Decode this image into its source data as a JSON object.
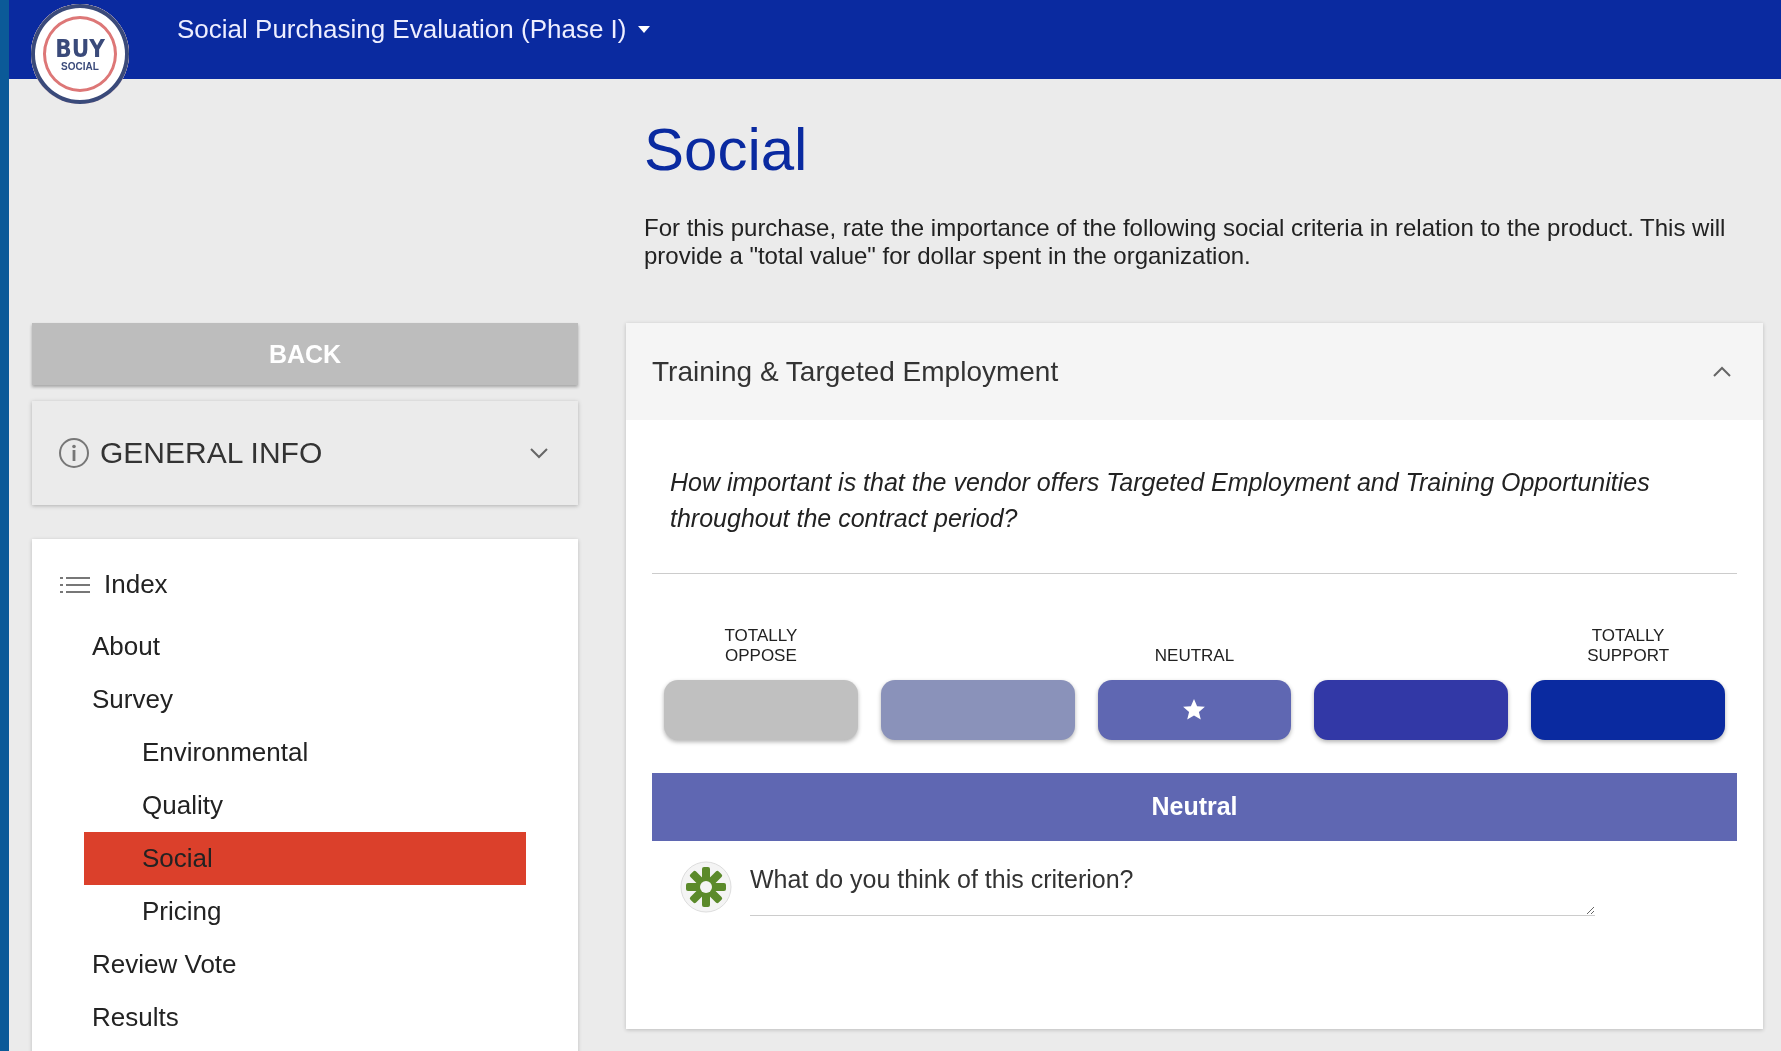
{
  "header": {
    "logo": {
      "line_1": "BUY",
      "line_2": "SOCIAL"
    },
    "title": "Social Purchasing Evaluation (Phase I)"
  },
  "sidebar": {
    "back_button": "BACK",
    "general_info": {
      "label": "GENERAL INFO",
      "expanded": false
    },
    "index": {
      "title": "Index",
      "items": [
        {
          "label": "About",
          "selected": false
        },
        {
          "label": "Survey",
          "selected": false,
          "children": [
            {
              "label": "Environmental",
              "selected": false
            },
            {
              "label": "Quality",
              "selected": false
            },
            {
              "label": "Social",
              "selected": true
            },
            {
              "label": "Pricing",
              "selected": false
            }
          ]
        },
        {
          "label": "Review Vote",
          "selected": false
        },
        {
          "label": "Results",
          "selected": false
        }
      ]
    }
  },
  "page": {
    "title": "Social",
    "description": "For this purchase, rate the importance of the following social criteria in relation to the product. This will provide a \"total value\" for dollar spent in the organization."
  },
  "criterion": {
    "title": "Training & Targeted Employment",
    "expanded": true,
    "question": "How important is that the vendor offers Targeted Employment and Training Opportunities throughout the contract period?",
    "scale": [
      {
        "label": "TOTALLY OPPOSE",
        "color": "#c0c0c0",
        "selected": false
      },
      {
        "color": "#8a92ba",
        "selected": false
      },
      {
        "label": "NEUTRAL",
        "color": "#5f67b2",
        "selected": true
      },
      {
        "color": "#3238a6",
        "selected": false
      },
      {
        "label": "TOTALLY SUPPORT",
        "color": "#0a2aa0",
        "selected": false
      }
    ],
    "result": "Neutral",
    "comment": {
      "placeholder": "What do you think of this criterion?"
    }
  }
}
